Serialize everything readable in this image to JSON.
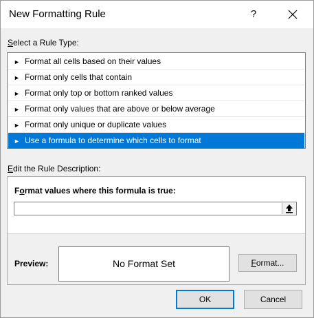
{
  "window": {
    "title": "New Formatting Rule",
    "help_label": "?",
    "close_icon": "close-icon"
  },
  "rule_type": {
    "label_accel": "S",
    "label_rest": "elect a Rule Type:",
    "items": [
      {
        "label": "Format all cells based on their values",
        "selected": false
      },
      {
        "label": "Format only cells that contain",
        "selected": false
      },
      {
        "label": "Format only top or bottom ranked values",
        "selected": false
      },
      {
        "label": "Format only values that are above or below average",
        "selected": false
      },
      {
        "label": "Format only unique or duplicate values",
        "selected": false
      },
      {
        "label": "Use a formula to determine which cells to format",
        "selected": true
      }
    ],
    "bullet": "►"
  },
  "description": {
    "label_accel": "E",
    "label_rest": "dit the Rule Description:",
    "formula_label_accel": "o",
    "formula_label_pre": "F",
    "formula_label_rest": "rmat values where this formula is true:",
    "formula_value": "",
    "collapse_icon": "collapse-dialog-icon",
    "preview_label": "Preview:",
    "preview_text": "No Format Set",
    "format_button_accel": "F",
    "format_button_rest": "ormat..."
  },
  "buttons": {
    "ok": "OK",
    "cancel": "Cancel"
  },
  "colors": {
    "selection": "#0078d7",
    "dialog_bg": "#f0f0f0",
    "button_bg": "#e1e1e1"
  }
}
